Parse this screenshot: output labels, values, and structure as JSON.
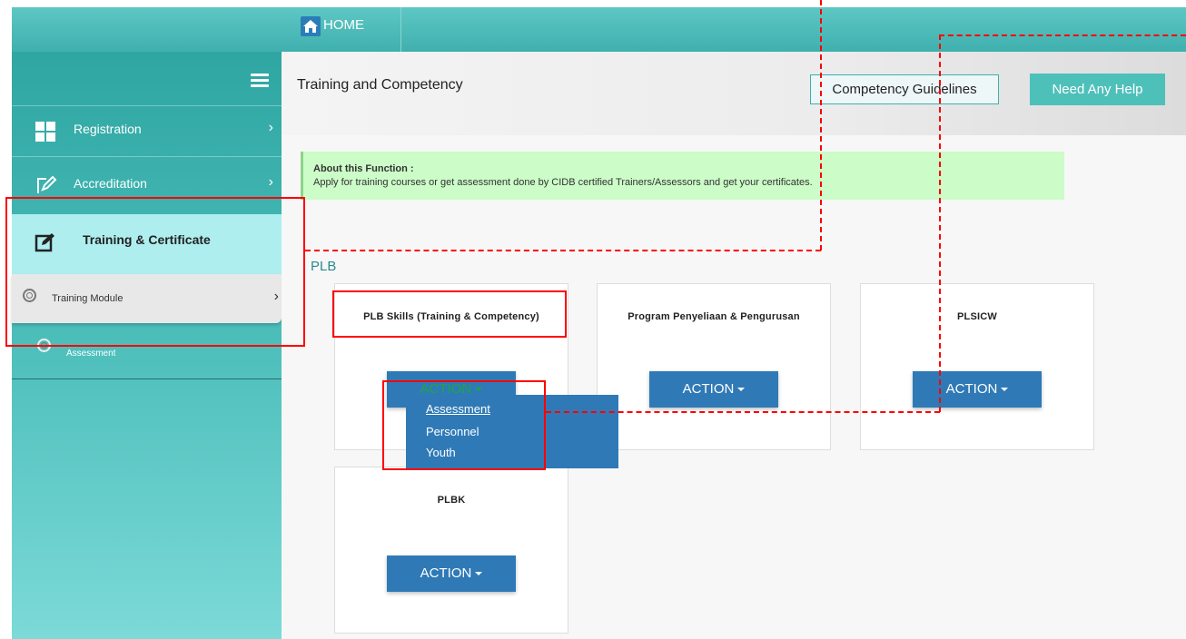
{
  "topbar": {
    "home_label": "HOME",
    "home_icon": "home-icon"
  },
  "sidebar": {
    "menu_icon": "hamburger-icon",
    "items": [
      {
        "label": "Registration",
        "icon": "grid-icon"
      },
      {
        "label": "Accreditation",
        "icon": "pencil-icon"
      },
      {
        "label": "Training & Certificate",
        "icon": "edit-icon"
      }
    ],
    "subitems": [
      {
        "label": "Training Module",
        "icon": "radio-icon"
      },
      {
        "label": "Assessment",
        "icon": "radio-icon"
      }
    ]
  },
  "header": {
    "title": "Training and Competency",
    "guidelines_label": "Competency Guidelines",
    "help_label": "Need Any Help"
  },
  "about": {
    "title": "About this Function :",
    "text": "Apply for training courses or get assessment done by CIDB certified Trainers/Assessors and get your certificates."
  },
  "section": {
    "label": "PLB"
  },
  "cards": [
    {
      "title": "PLB Skills (Training & Competency)",
      "action": "ACTION"
    },
    {
      "title": "Program Penyeliaan & Pengurusan",
      "action": "ACTION"
    },
    {
      "title": "PLSICW",
      "action": "ACTION"
    },
    {
      "title": "PLBK",
      "action": "ACTION"
    }
  ],
  "dropdown": {
    "options": [
      "Assessment",
      "Personnel",
      "Youth"
    ]
  },
  "colors": {
    "teal": "#3fb0ae",
    "action_blue": "#2f7ab6",
    "about_bg": "#ccfcc8",
    "annotation_red": "#ff0000"
  }
}
